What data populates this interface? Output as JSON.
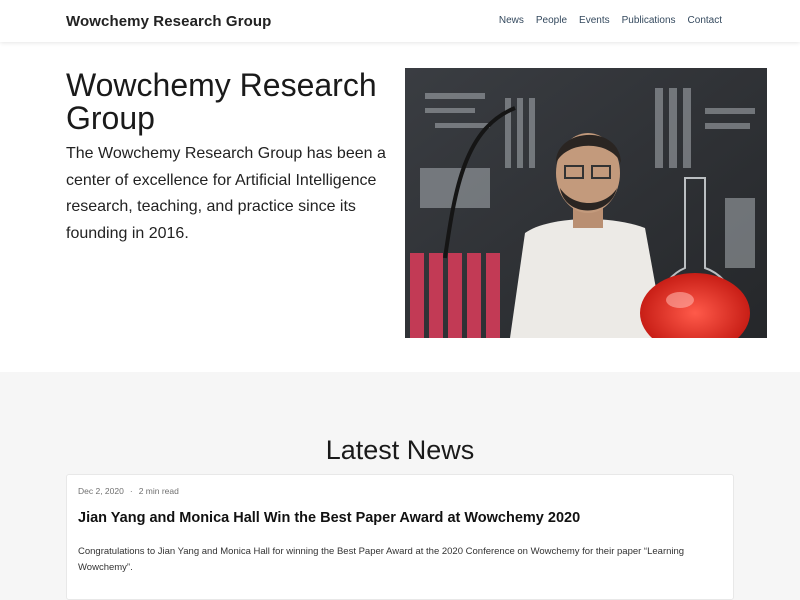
{
  "navbar": {
    "brand": "Wowchemy Research Group",
    "links": [
      "News",
      "People",
      "Events",
      "Publications",
      "Contact"
    ]
  },
  "hero": {
    "title": "Wowchemy Research Group",
    "text": "The Wowchemy Research Group has been a center of excellence for Artificial Intelligence research, teaching, and practice since its founding in 2016."
  },
  "news": {
    "heading": "Latest News",
    "items": [
      {
        "date": "Dec 2, 2020",
        "separator": "·",
        "read_time": "2 min read",
        "title": "Jian Yang and Monica Hall Win the Best Paper Award at Wowchemy 2020",
        "summary": "Congratulations to Jian Yang and Monica Hall for winning the Best Paper Award at the 2020 Conference on Wowchemy for their paper “Learning Wowchemy”."
      }
    ]
  },
  "colors": {
    "nav_link": "#34495e",
    "news_background": "#f6f6f6"
  }
}
